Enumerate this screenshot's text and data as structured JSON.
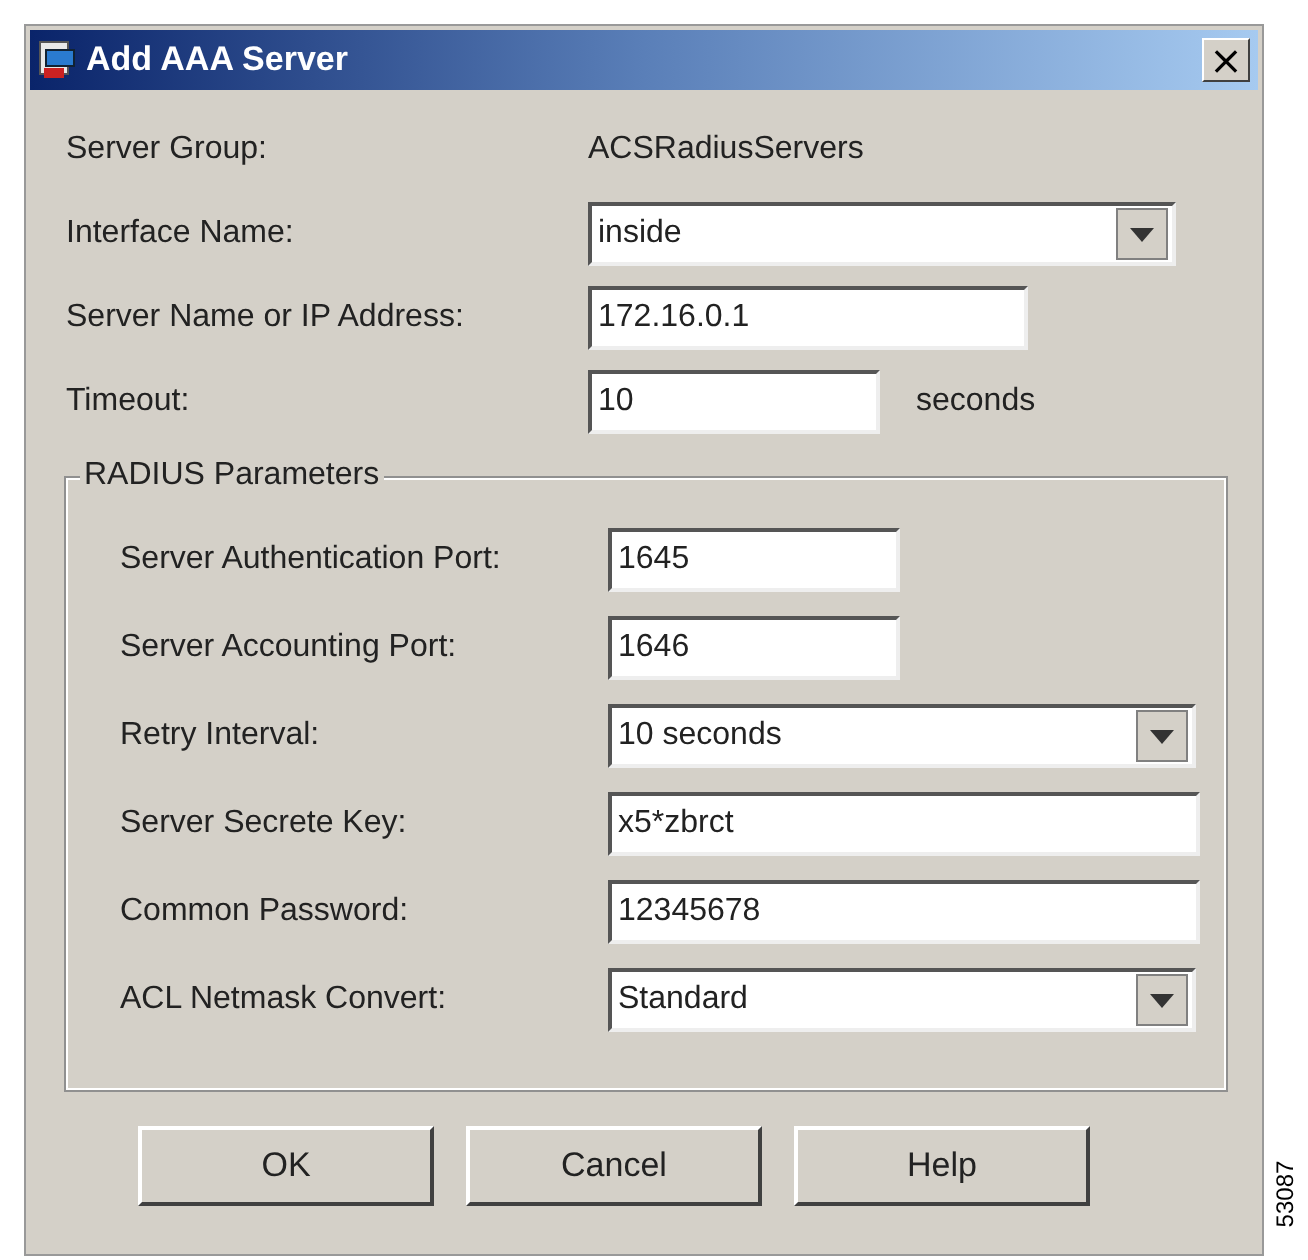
{
  "window": {
    "title": "Add AAA Server",
    "close": "×"
  },
  "fields": [
    {
      "kind": "text",
      "label": "Server Group:",
      "value": "ACSRadiusServers"
    },
    {
      "kind": "dropdown",
      "label": "Interface Name:",
      "value": "inside"
    },
    {
      "kind": "address",
      "label": "Server Name or IP Address:",
      "value": "172.16.0.1"
    },
    {
      "kind": "number",
      "label": "Timeout:",
      "value": "10",
      "suffix": "seconds"
    }
  ],
  "radius_parameters": {
    "title": "RADIUS Parameters",
    "fields": [
      {
        "kind": "number",
        "label": "Server Authentication Port:",
        "value": "1645"
      },
      {
        "kind": "number",
        "label": "Server Accounting Port:",
        "value": "1646"
      },
      {
        "kind": "dropdown",
        "label": "Retry Interval:",
        "value": "10 seconds"
      },
      {
        "kind": "secret",
        "label": "Server Secrete Key:",
        "value": "x5*zbrct"
      },
      {
        "kind": "secret",
        "label": "Common Password:",
        "value": "12345678"
      },
      {
        "kind": "dropdown",
        "label": "ACL Netmask Convert:",
        "value": "Standard"
      }
    ]
  },
  "buttons": [
    "OK",
    "Cancel",
    "Help"
  ],
  "figure_number": "53087"
}
